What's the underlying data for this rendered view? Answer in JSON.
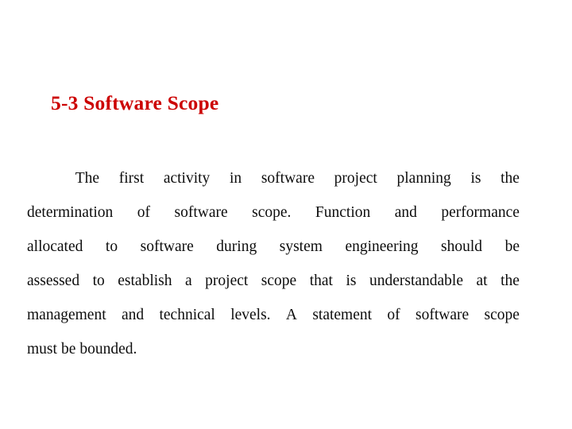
{
  "slide": {
    "background_color": "#ffffff",
    "title": "5-3 Software Scope",
    "title_color": "#cc0000",
    "body_color": "#000000",
    "paragraph_full_text": "The first activity in software project planning is the determination of software scope. Function and performance allocated to software during system engineering should be assessed to establish a project scope that is understandable at the management and technical levels. A statement of software scope must be bounded.",
    "lines": [
      {
        "id": "line-1",
        "mode": "stretch",
        "indent": true,
        "words": [
          "The",
          "first",
          "activity",
          "in",
          "software",
          "project",
          "planning",
          "is",
          "the"
        ]
      },
      {
        "id": "line-2",
        "mode": "stretch",
        "indent": false,
        "words": [
          "determination",
          "of",
          "software",
          "scope.",
          "Function",
          "and",
          "performance"
        ]
      },
      {
        "id": "line-3",
        "mode": "stretch",
        "indent": false,
        "words": [
          "allocated",
          "to",
          "software",
          "during",
          "system",
          "engineering",
          "should",
          "be"
        ]
      },
      {
        "id": "line-4",
        "mode": "snug",
        "indent": false,
        "words": [
          "assessed",
          "to",
          "establish",
          "a",
          "project",
          "scope",
          "that",
          "is",
          "understandable",
          "at",
          "the"
        ]
      },
      {
        "id": "line-5",
        "mode": "snug",
        "indent": false,
        "words": [
          "management",
          "and",
          "technical",
          "levels.",
          "A",
          "statement",
          "of",
          "software",
          "scope"
        ]
      },
      {
        "id": "line-6",
        "mode": "ragged",
        "indent": false,
        "words": [
          "must",
          "be",
          "bounded."
        ]
      }
    ]
  }
}
